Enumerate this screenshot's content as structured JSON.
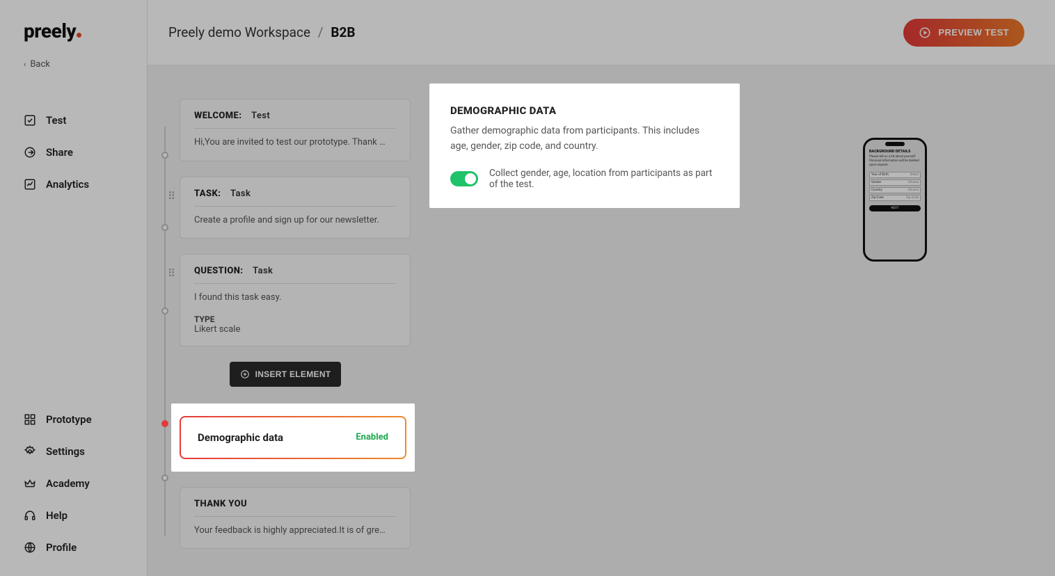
{
  "logo": "preely",
  "back_label": "Back",
  "nav": {
    "test": "Test",
    "share": "Share",
    "analytics": "Analytics",
    "prototype": "Prototype",
    "settings": "Settings",
    "academy": "Academy",
    "help": "Help",
    "profile": "Profile"
  },
  "breadcrumb": {
    "workspace": "Preely demo Workspace",
    "sep": "/",
    "current": "B2B"
  },
  "preview_btn": "PREVIEW TEST",
  "flow": {
    "welcome": {
      "head": "WELCOME:",
      "title": "Test",
      "desc": "Hi,You are invited to test our prototype. Thank …"
    },
    "task": {
      "head": "TASK:",
      "title": "Task",
      "desc": "Create a profile and sign up for our newsletter."
    },
    "question": {
      "head": "QUESTION:",
      "title": "Task",
      "desc": "I found this task easy.",
      "type_label": "TYPE",
      "type_value": "Likert scale"
    },
    "insert_btn": "INSERT ELEMENT",
    "demographic": {
      "title": "Demographic data",
      "status": "Enabled"
    },
    "thankyou": {
      "head": "THANK YOU",
      "desc": "Your feedback is highly appreciated.It is of gre…"
    }
  },
  "detail": {
    "heading": "DEMOGRAPHIC DATA",
    "body": "Gather demographic data from participants. This includes age, gender, zip code, and country.",
    "toggle_label": "Collect gender, age, location from participants as part of the test."
  },
  "phone": {
    "title": "BACKGROUND DETAILS",
    "sub": "Please tell us a bit about yourself. Personal information will be deleted upon request.",
    "fields": [
      {
        "label": "Year of Birth",
        "hint": "Select"
      },
      {
        "label": "Gender",
        "hint": "Choose"
      },
      {
        "label": "Country",
        "hint": "Choose"
      },
      {
        "label": "Zip Code",
        "hint": "Zip Code"
      }
    ],
    "next": "NEXT"
  }
}
